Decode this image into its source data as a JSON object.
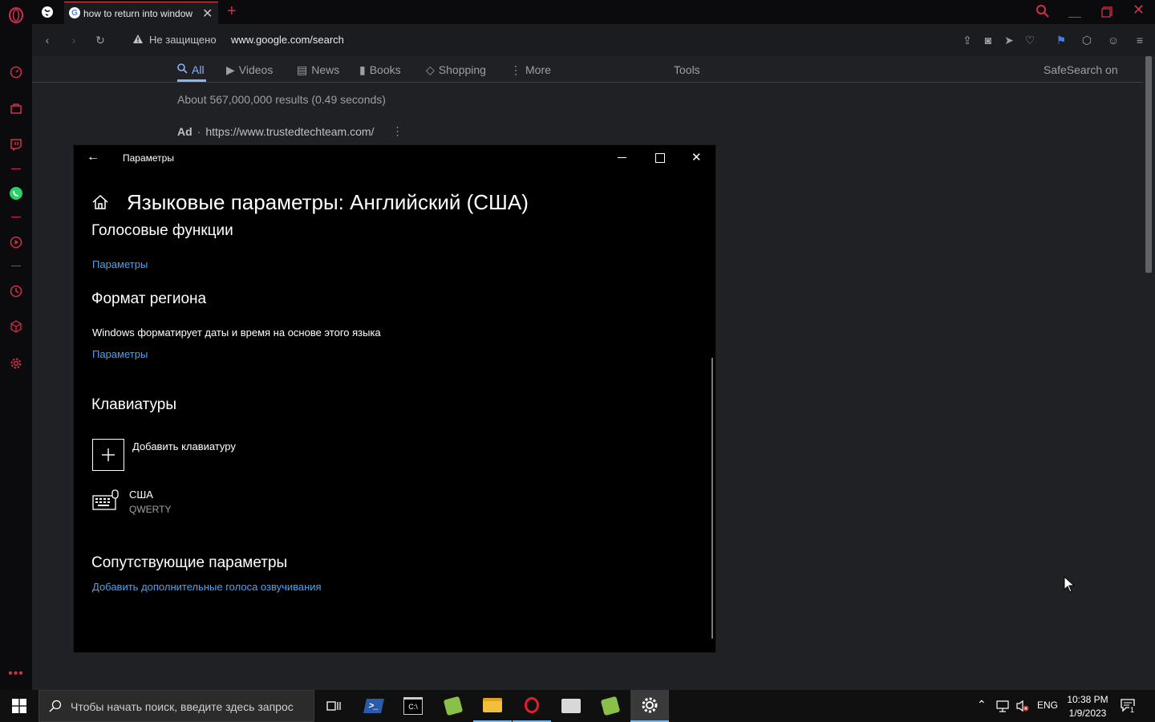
{
  "browser": {
    "tab": {
      "title": "how to return into window"
    },
    "address": {
      "security_label": "Не защищено",
      "url": "www.google.com/search"
    }
  },
  "google": {
    "nav": [
      {
        "label": "All"
      },
      {
        "label": "Videos"
      },
      {
        "label": "News"
      },
      {
        "label": "Books"
      },
      {
        "label": "Shopping"
      },
      {
        "label": "More"
      }
    ],
    "tools_label": "Tools",
    "safesearch_label": "SafeSearch on",
    "results_count": "About 567,000,000 results (0.49 seconds)",
    "ad": {
      "badge": "Ad",
      "separator": "·",
      "url": "https://www.trustedtechteam.com/"
    }
  },
  "settings": {
    "window_title": "Параметры",
    "page_title": "Языковые параметры: Английский (США)",
    "voice": {
      "heading": "Голосовые функции",
      "link": "Параметры"
    },
    "region": {
      "heading": "Формат региона",
      "description": "Windows форматирует даты и время на основе этого языка",
      "link": "Параметры"
    },
    "keyboards": {
      "heading": "Клавиатуры",
      "add_label": "Добавить клавиатуру",
      "items": [
        {
          "name": "США",
          "layout": "QWERTY"
        }
      ]
    },
    "related": {
      "heading": "Сопутствующие параметры",
      "link": "Добавить дополнительные голоса озвучивания"
    }
  },
  "taskbar": {
    "search_placeholder": "Чтобы начать поиск, введите здесь запрос",
    "language": "ENG",
    "time": "10:38 PM",
    "date": "1/9/2023",
    "notification_count": "1"
  },
  "colors": {
    "opera_red": "#d1304a",
    "link_blue": "#4aa3f2",
    "google_blue": "#8ab4f8"
  }
}
